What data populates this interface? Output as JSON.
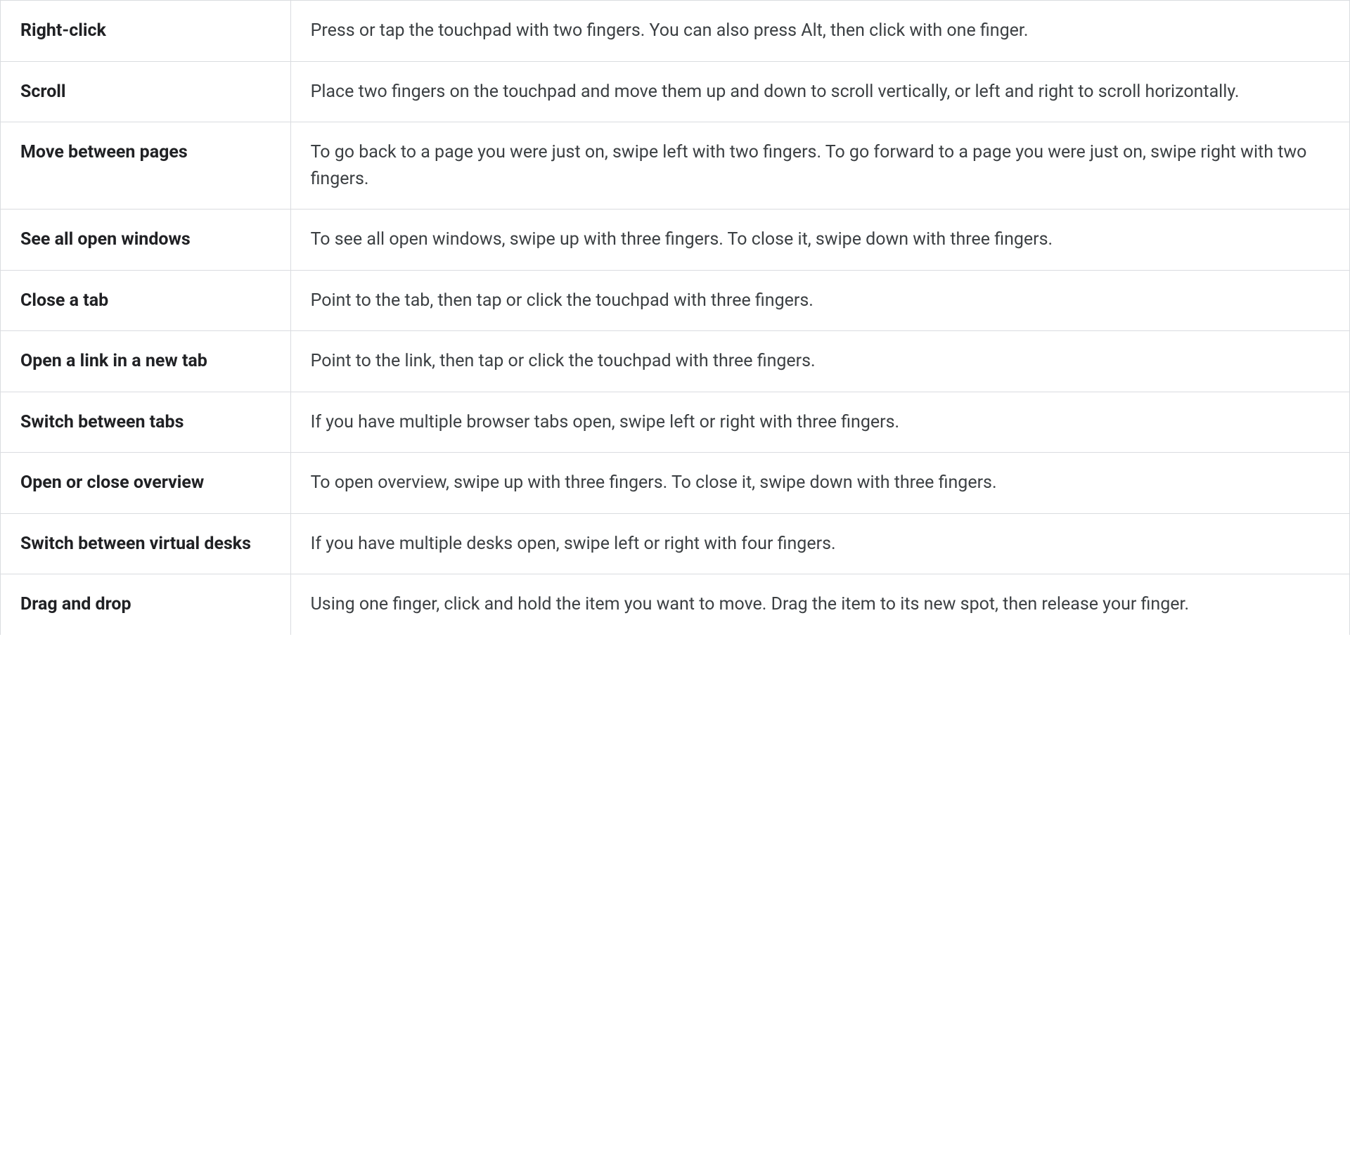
{
  "gestures": [
    {
      "name": "Right-click",
      "description": "Press or tap the touchpad with two fingers. You can also press Alt, then click with one finger."
    },
    {
      "name": "Scroll",
      "description": "Place two fingers on the touchpad and move them up and down to scroll vertically, or left and right to scroll horizontally."
    },
    {
      "name": "Move between pages",
      "description": "To go back to a page you were just on, swipe left with two fingers. To go forward to a page you were just on, swipe right with two fingers."
    },
    {
      "name": "See all open windows",
      "description": "To see all open windows, swipe up with three fingers. To close it, swipe down with three fingers."
    },
    {
      "name": "Close a tab",
      "description": "Point to the tab, then tap or click the touchpad with three fingers."
    },
    {
      "name": "Open a link in a new tab",
      "description": "Point to the link, then tap or click the touchpad with three fingers."
    },
    {
      "name": "Switch between tabs",
      "description": "If you have multiple browser tabs open, swipe left or right with three fingers."
    },
    {
      "name": "Open or close overview",
      "description": "To open overview, swipe up with three fingers. To close it, swipe down with three fingers."
    },
    {
      "name": "Switch between virtual desks",
      "description": "If you have multiple desks open, swipe left or right with four fingers."
    },
    {
      "name": "Drag and drop",
      "description": "Using one finger, click and hold the item you want to move. Drag the item to its new spot, then release your finger."
    }
  ]
}
